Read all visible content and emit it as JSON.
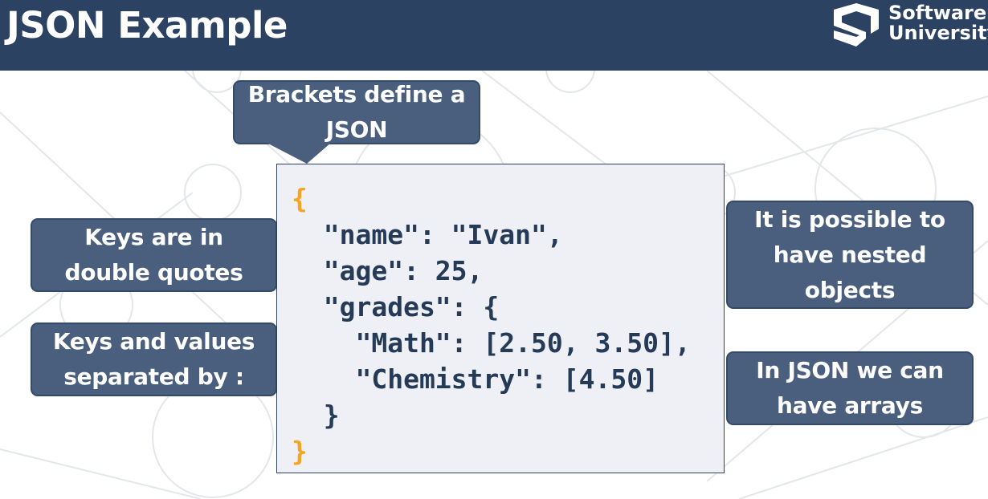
{
  "header": {
    "title": "JSON Example",
    "logo": {
      "icon": "softuni-logo-icon",
      "line1": "Software",
      "line2": "University"
    }
  },
  "callouts": {
    "brackets": {
      "line1": "Brackets define a",
      "line2": "JSON"
    },
    "keys_quotes": {
      "line1": "Keys are in",
      "line2": "double quotes"
    },
    "keys_values": {
      "line1": "Keys and values",
      "line2": "separated by :"
    },
    "nested": {
      "line1": "It is possible to",
      "line2": "have nested",
      "line3": "objects"
    },
    "arrays": {
      "line1": "In JSON we can",
      "line2": "have arrays"
    }
  },
  "code": {
    "lines": [
      "{",
      "  \"name\": \"Ivan\",",
      "  \"age\": 25,",
      "  \"grades\": {",
      "    \"Math\": [2.50, 3.50],",
      "    \"Chemistry\": [4.50]",
      "  }",
      "}"
    ]
  },
  "colors": {
    "header_bg": "#2b4263",
    "callout_bg": "#4a5f7e",
    "code_bg": "#eef0f5",
    "brace_accent": "#f4a522",
    "code_text": "#253a57"
  }
}
